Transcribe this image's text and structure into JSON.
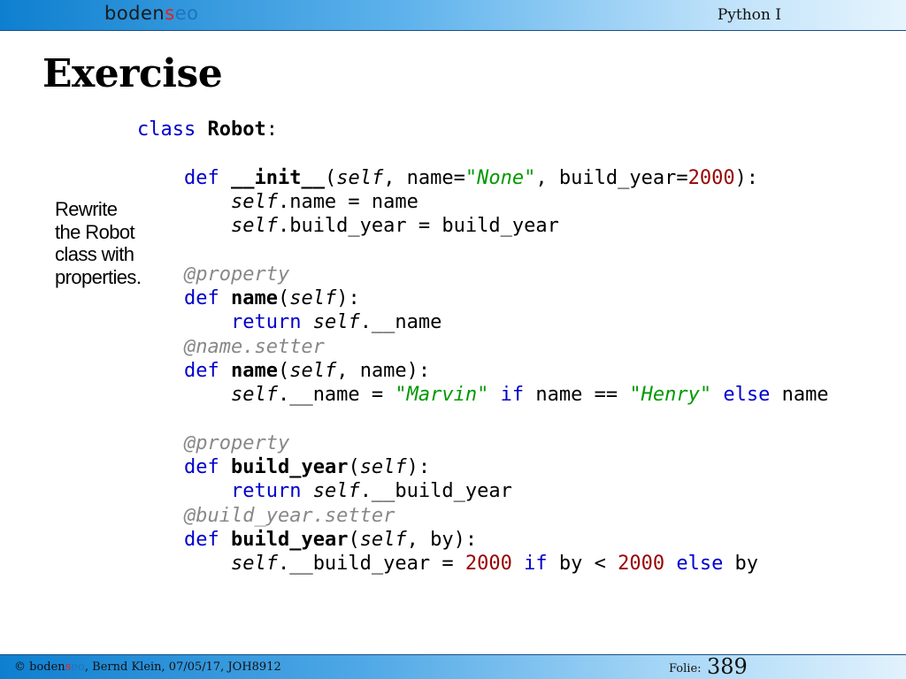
{
  "header": {
    "logo_prefix": "boden",
    "logo_accent": "s",
    "logo_suffix": "eo",
    "course_title": "Python I"
  },
  "slide": {
    "title": "Exercise",
    "note_lines": [
      "Rewrite",
      "the Robot",
      "class with",
      "properties."
    ]
  },
  "code_lines": [
    [
      {
        "t": "kw",
        "v": "class"
      },
      {
        "t": "plain",
        "v": " "
      },
      {
        "t": "bold",
        "v": "Robot"
      },
      {
        "t": "plain",
        "v": ":"
      }
    ],
    [],
    [
      {
        "t": "plain",
        "v": "    "
      },
      {
        "t": "kw",
        "v": "def"
      },
      {
        "t": "plain",
        "v": " "
      },
      {
        "t": "bold",
        "v": "__init__"
      },
      {
        "t": "plain",
        "v": "("
      },
      {
        "t": "self",
        "v": "self"
      },
      {
        "t": "plain",
        "v": ", name="
      },
      {
        "t": "q",
        "v": "\""
      },
      {
        "t": "str",
        "v": "None"
      },
      {
        "t": "q",
        "v": "\""
      },
      {
        "t": "plain",
        "v": ", build_year="
      },
      {
        "t": "num",
        "v": "2000"
      },
      {
        "t": "plain",
        "v": "):"
      }
    ],
    [
      {
        "t": "plain",
        "v": "        "
      },
      {
        "t": "self",
        "v": "self"
      },
      {
        "t": "plain",
        "v": ".name = name"
      }
    ],
    [
      {
        "t": "plain",
        "v": "        "
      },
      {
        "t": "self",
        "v": "self"
      },
      {
        "t": "plain",
        "v": ".build_year = build_year"
      }
    ],
    [],
    [
      {
        "t": "plain",
        "v": "    "
      },
      {
        "t": "dec",
        "v": "@property"
      }
    ],
    [
      {
        "t": "plain",
        "v": "    "
      },
      {
        "t": "kw",
        "v": "def"
      },
      {
        "t": "plain",
        "v": " "
      },
      {
        "t": "bold",
        "v": "name"
      },
      {
        "t": "plain",
        "v": "("
      },
      {
        "t": "self",
        "v": "self"
      },
      {
        "t": "plain",
        "v": "):"
      }
    ],
    [
      {
        "t": "plain",
        "v": "        "
      },
      {
        "t": "kw",
        "v": "return"
      },
      {
        "t": "plain",
        "v": " "
      },
      {
        "t": "self",
        "v": "self"
      },
      {
        "t": "plain",
        "v": ".__name"
      }
    ],
    [
      {
        "t": "plain",
        "v": "    "
      },
      {
        "t": "dec",
        "v": "@name.setter"
      }
    ],
    [
      {
        "t": "plain",
        "v": "    "
      },
      {
        "t": "kw",
        "v": "def"
      },
      {
        "t": "plain",
        "v": " "
      },
      {
        "t": "bold",
        "v": "name"
      },
      {
        "t": "plain",
        "v": "("
      },
      {
        "t": "self",
        "v": "self"
      },
      {
        "t": "plain",
        "v": ", name):"
      }
    ],
    [
      {
        "t": "plain",
        "v": "        "
      },
      {
        "t": "self",
        "v": "self"
      },
      {
        "t": "plain",
        "v": ".__name = "
      },
      {
        "t": "q",
        "v": "\""
      },
      {
        "t": "str",
        "v": "Marvin"
      },
      {
        "t": "q",
        "v": "\""
      },
      {
        "t": "plain",
        "v": " "
      },
      {
        "t": "kw",
        "v": "if"
      },
      {
        "t": "plain",
        "v": " name == "
      },
      {
        "t": "q",
        "v": "\""
      },
      {
        "t": "str",
        "v": "Henry"
      },
      {
        "t": "q",
        "v": "\""
      },
      {
        "t": "plain",
        "v": " "
      },
      {
        "t": "kw",
        "v": "else"
      },
      {
        "t": "plain",
        "v": " name"
      }
    ],
    [],
    [
      {
        "t": "plain",
        "v": "    "
      },
      {
        "t": "dec",
        "v": "@property"
      }
    ],
    [
      {
        "t": "plain",
        "v": "    "
      },
      {
        "t": "kw",
        "v": "def"
      },
      {
        "t": "plain",
        "v": " "
      },
      {
        "t": "bold",
        "v": "build_year"
      },
      {
        "t": "plain",
        "v": "("
      },
      {
        "t": "self",
        "v": "self"
      },
      {
        "t": "plain",
        "v": "):"
      }
    ],
    [
      {
        "t": "plain",
        "v": "        "
      },
      {
        "t": "kw",
        "v": "return"
      },
      {
        "t": "plain",
        "v": " "
      },
      {
        "t": "self",
        "v": "self"
      },
      {
        "t": "plain",
        "v": ".__build_year"
      }
    ],
    [
      {
        "t": "plain",
        "v": "    "
      },
      {
        "t": "dec",
        "v": "@build_year.setter"
      }
    ],
    [
      {
        "t": "plain",
        "v": "    "
      },
      {
        "t": "kw",
        "v": "def"
      },
      {
        "t": "plain",
        "v": " "
      },
      {
        "t": "bold",
        "v": "build_year"
      },
      {
        "t": "plain",
        "v": "("
      },
      {
        "t": "self",
        "v": "self"
      },
      {
        "t": "plain",
        "v": ", by):"
      }
    ],
    [
      {
        "t": "plain",
        "v": "        "
      },
      {
        "t": "self",
        "v": "self"
      },
      {
        "t": "plain",
        "v": ".__build_year = "
      },
      {
        "t": "num",
        "v": "2000"
      },
      {
        "t": "plain",
        "v": " "
      },
      {
        "t": "kw",
        "v": "if"
      },
      {
        "t": "plain",
        "v": " by < "
      },
      {
        "t": "num",
        "v": "2000"
      },
      {
        "t": "plain",
        "v": " "
      },
      {
        "t": "kw",
        "v": "else"
      },
      {
        "t": "plain",
        "v": " by"
      }
    ]
  ],
  "footer": {
    "copyright_symbol": "©",
    "logo_prefix": "boden",
    "logo_accent": "s",
    "logo_suffix": "eo",
    "author_info": ", Bernd Klein, 07/05/17, JOH8912",
    "folie_label": "Folie:",
    "folie_number": "389"
  },
  "colors": {
    "keyword": "#0000cc",
    "string": "#009900",
    "number": "#990000",
    "decorator": "#888888",
    "logo_accent": "#e2231a",
    "header_blue": "#0e7fcf"
  }
}
